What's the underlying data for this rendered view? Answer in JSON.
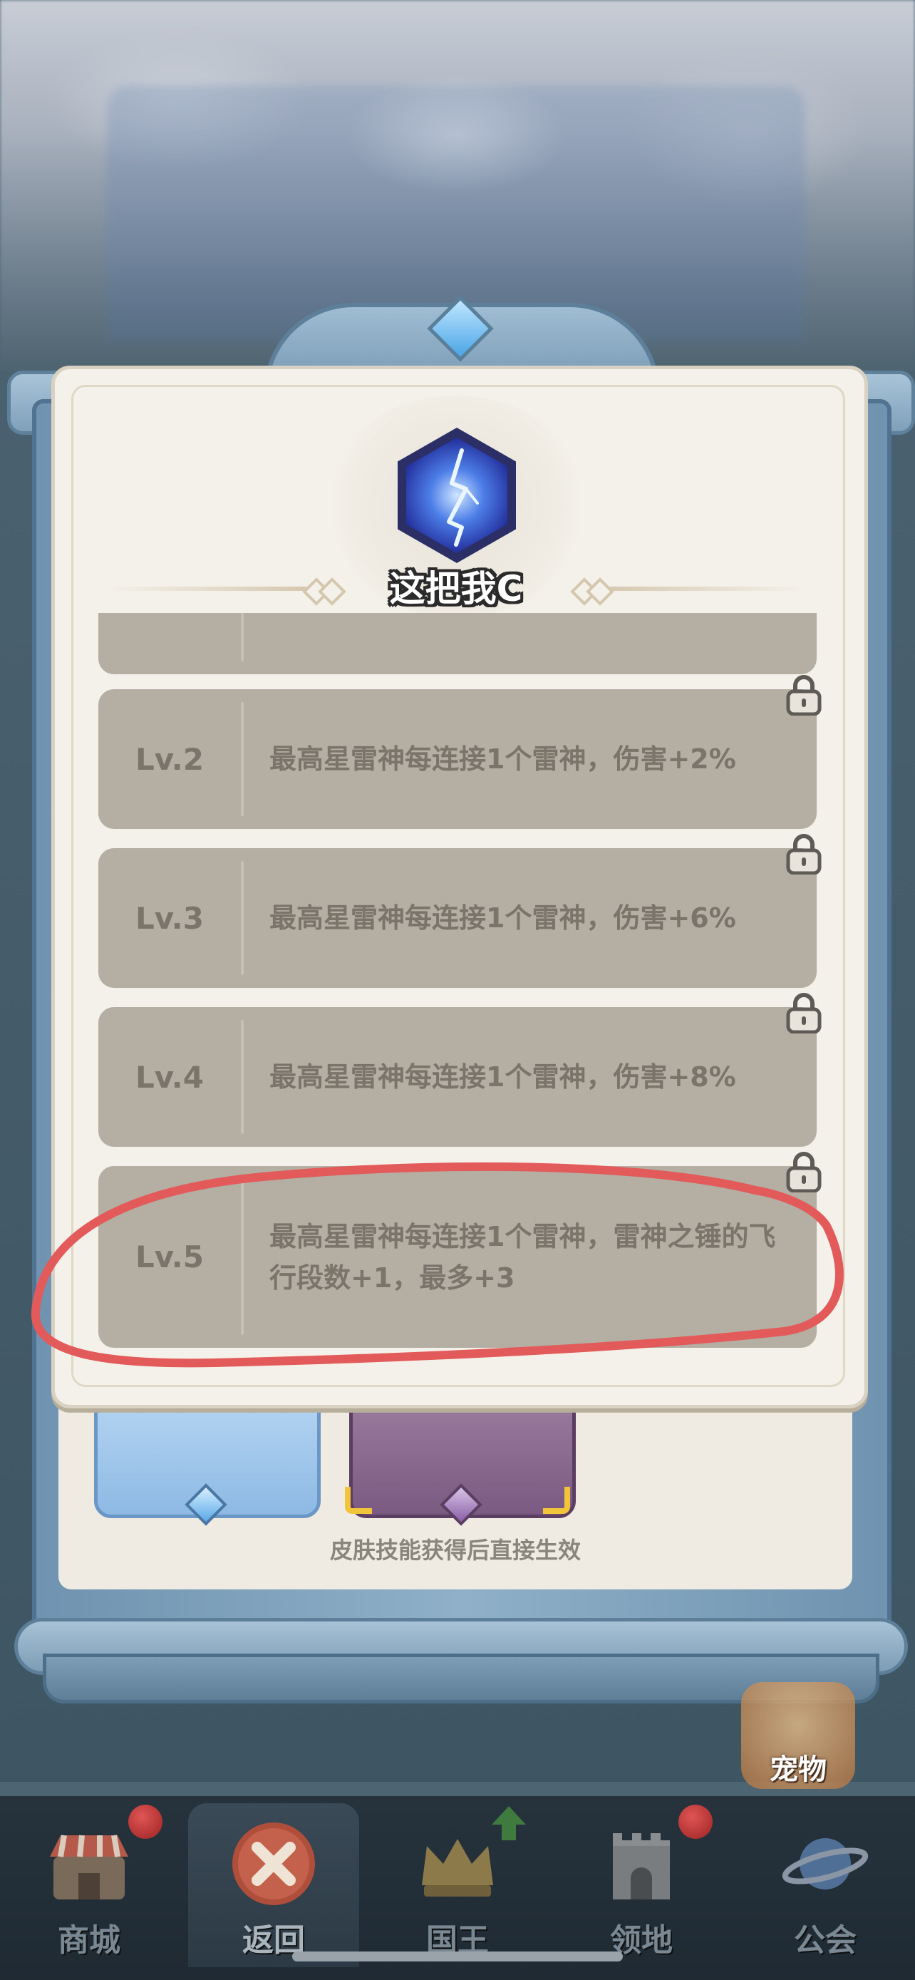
{
  "skill": {
    "title": "这把我C",
    "icon": "lightning-skill-icon"
  },
  "levels": [
    {
      "label": "",
      "description": "",
      "locked": false
    },
    {
      "label": "Lv.2",
      "description": "最高星雷神每连接1个雷神，伤害+2%",
      "locked": true
    },
    {
      "label": "Lv.3",
      "description": "最高星雷神每连接1个雷神，伤害+6%",
      "locked": true
    },
    {
      "label": "Lv.4",
      "description": "最高星雷神每连接1个雷神，伤害+8%",
      "locked": true
    },
    {
      "label": "Lv.5",
      "description": "最高星雷神每连接1个雷神，雷神之锤的飞行段数+1，最多+3",
      "locked": true
    }
  ],
  "skin_note": "皮肤技能获得后直接生效",
  "pet_button": {
    "label": "宠物"
  },
  "nav": {
    "items": [
      {
        "label": "商城",
        "icon": "shop-icon",
        "badge": true
      },
      {
        "label": "返回",
        "icon": "close-icon",
        "badge": false,
        "active": true
      },
      {
        "label": "国王",
        "icon": "crown-icon",
        "badge": false,
        "upgrade_arrow": true
      },
      {
        "label": "领地",
        "icon": "castle-icon",
        "badge": true
      },
      {
        "label": "公会",
        "icon": "planet-icon",
        "badge": false
      }
    ]
  },
  "colors": {
    "modal_bg": "#f4f1ea",
    "row_bg": "#b4aea3",
    "row_text": "#7a746a",
    "annotation_red": "#e35a5a",
    "nav_bg": "#26333d"
  }
}
